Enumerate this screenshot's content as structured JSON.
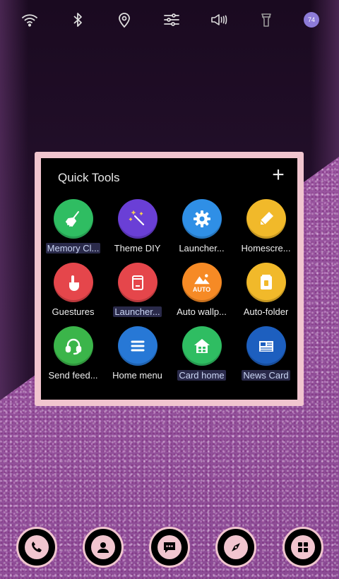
{
  "status_bar": {
    "icons": [
      "wifi-icon",
      "bluetooth-icon",
      "location-icon",
      "equalizer-icon",
      "vibrate-icon",
      "flashlight-icon"
    ],
    "battery_badge": "74"
  },
  "quick_tools": {
    "title": "Quick Tools",
    "add_label": "+",
    "tiles": [
      {
        "label": "Memory Cl...",
        "color": "#2fbd62",
        "icon": "broom-icon",
        "highlight": true
      },
      {
        "label": "Theme DIY",
        "color": "#6a3fd6",
        "icon": "magic-wand-icon",
        "highlight": false
      },
      {
        "label": "Launcher...",
        "color": "#2f8fe6",
        "icon": "gear-icon",
        "highlight": false
      },
      {
        "label": "Homescre...",
        "color": "#f1b92a",
        "icon": "pencil-icon",
        "highlight": false
      },
      {
        "label": "Guestures",
        "color": "#e5464b",
        "icon": "hand-icon",
        "highlight": false
      },
      {
        "label": "Launcher...",
        "color": "#e5464b",
        "icon": "trash-icon",
        "highlight": true
      },
      {
        "label": "Auto wallp...",
        "color": "#f68a25",
        "icon": "wallpaper-icon",
        "highlight": false
      },
      {
        "label": "Auto-folder",
        "color": "#f1b92a",
        "icon": "folder-icon",
        "highlight": false
      },
      {
        "label": "Send feed...",
        "color": "#3bb54a",
        "icon": "headset-icon",
        "highlight": false
      },
      {
        "label": "Home menu",
        "color": "#2778d6",
        "icon": "menu-icon",
        "highlight": false
      },
      {
        "label": "Card home",
        "color": "#2fbd62",
        "icon": "home-card-icon",
        "highlight": true
      },
      {
        "label": "News Card",
        "color": "#1d5fbf",
        "icon": "newspaper-icon",
        "highlight": true
      }
    ],
    "auto_badge": "AUTO"
  },
  "dock": {
    "items": [
      "phone-icon",
      "contacts-icon",
      "messages-icon",
      "browser-icon",
      "apps-icon"
    ]
  }
}
